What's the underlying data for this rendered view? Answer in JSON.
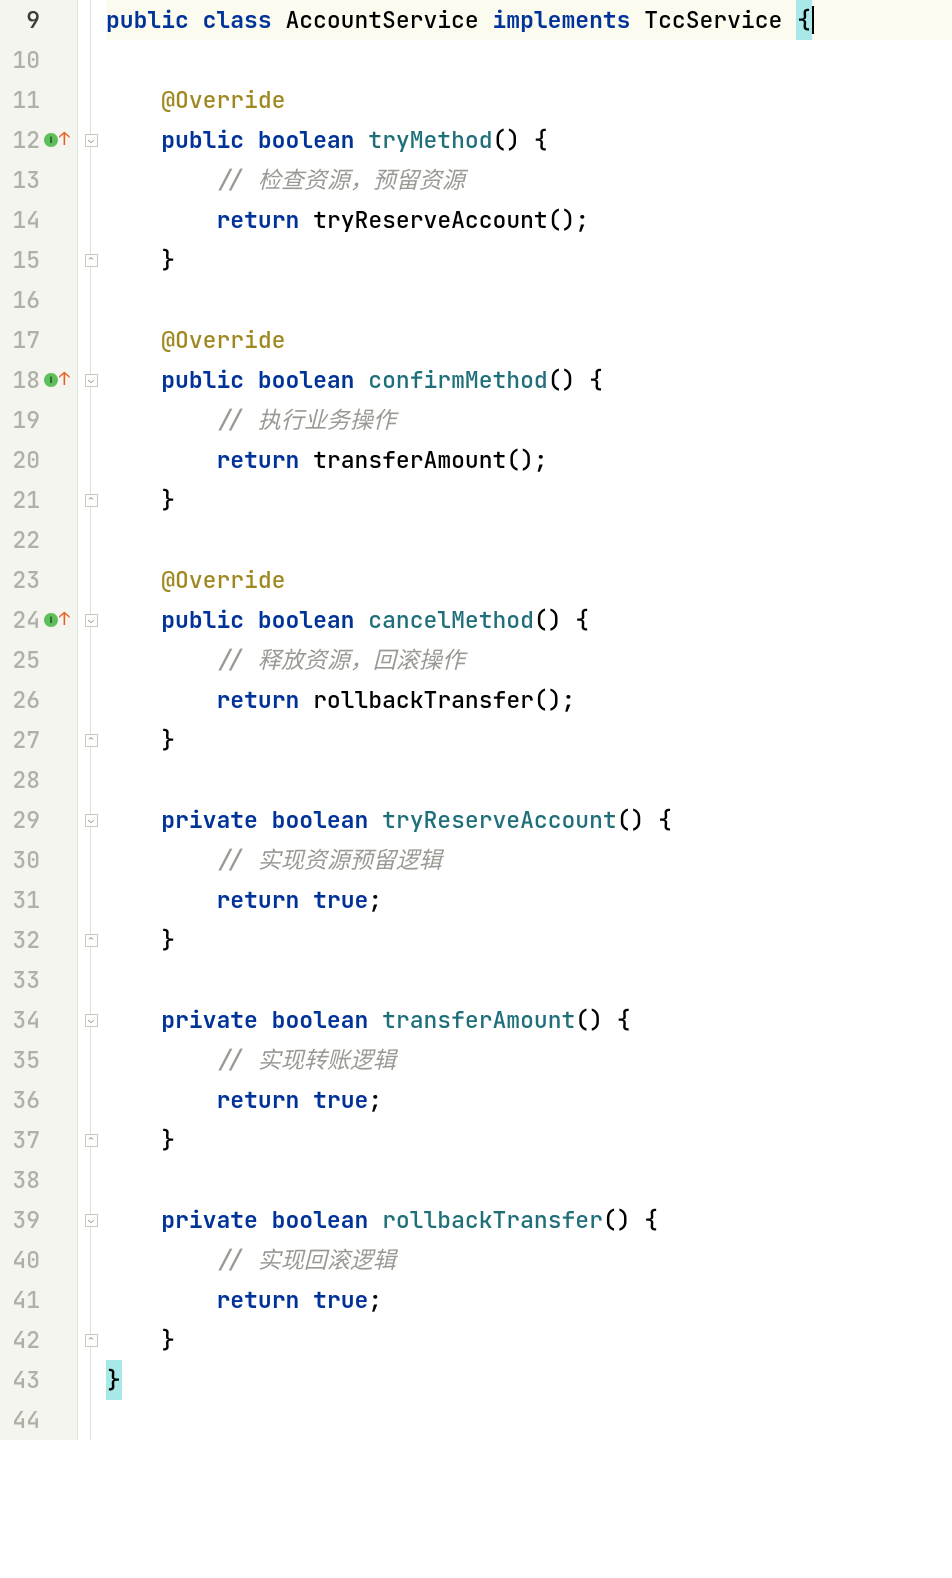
{
  "code": {
    "lines": [
      {
        "n": 9,
        "cur": true,
        "marker": "",
        "fold": "",
        "t": [
          [
            "kw",
            "public"
          ],
          [
            "sp",
            " "
          ],
          [
            "kw",
            "class"
          ],
          [
            "sp",
            " "
          ],
          [
            "cls",
            "AccountService"
          ],
          [
            "sp",
            " "
          ],
          [
            "kw",
            "implements"
          ],
          [
            "sp",
            " "
          ],
          [
            "cls",
            "TccService"
          ],
          [
            "sp",
            " "
          ],
          [
            "hl-brace",
            "{"
          ],
          [
            "cursor",
            ""
          ]
        ]
      },
      {
        "n": 10,
        "marker": "",
        "fold": "",
        "t": []
      },
      {
        "n": 11,
        "marker": "",
        "fold": "",
        "t": [
          [
            "ind",
            "    "
          ],
          [
            "ann",
            "@Override"
          ]
        ]
      },
      {
        "n": 12,
        "marker": "iarrow",
        "fold": "open",
        "t": [
          [
            "ind",
            "    "
          ],
          [
            "kw",
            "public"
          ],
          [
            "sp",
            " "
          ],
          [
            "kw",
            "boolean"
          ],
          [
            "sp",
            " "
          ],
          [
            "mname",
            "tryMethod"
          ],
          [
            "cls",
            "() {"
          ]
        ]
      },
      {
        "n": 13,
        "marker": "",
        "fold": "",
        "t": [
          [
            "ind",
            "        "
          ],
          [
            "com",
            "// "
          ],
          [
            "com-zh",
            "检查资源，预留资源"
          ]
        ]
      },
      {
        "n": 14,
        "marker": "",
        "fold": "",
        "t": [
          [
            "ind",
            "        "
          ],
          [
            "kw",
            "return"
          ],
          [
            "sp",
            " "
          ],
          [
            "cls",
            "tryReserveAccount();"
          ]
        ]
      },
      {
        "n": 15,
        "marker": "",
        "fold": "close",
        "t": [
          [
            "ind",
            "    "
          ],
          [
            "cls",
            "}"
          ]
        ]
      },
      {
        "n": 16,
        "marker": "",
        "fold": "",
        "t": []
      },
      {
        "n": 17,
        "marker": "",
        "fold": "",
        "t": [
          [
            "ind",
            "    "
          ],
          [
            "ann",
            "@Override"
          ]
        ]
      },
      {
        "n": 18,
        "marker": "iarrow",
        "fold": "open",
        "t": [
          [
            "ind",
            "    "
          ],
          [
            "kw",
            "public"
          ],
          [
            "sp",
            " "
          ],
          [
            "kw",
            "boolean"
          ],
          [
            "sp",
            " "
          ],
          [
            "mname",
            "confirmMethod"
          ],
          [
            "cls",
            "() {"
          ]
        ]
      },
      {
        "n": 19,
        "marker": "",
        "fold": "",
        "t": [
          [
            "ind",
            "        "
          ],
          [
            "com",
            "// "
          ],
          [
            "com-zh",
            "执行业务操作"
          ]
        ]
      },
      {
        "n": 20,
        "marker": "",
        "fold": "",
        "t": [
          [
            "ind",
            "        "
          ],
          [
            "kw",
            "return"
          ],
          [
            "sp",
            " "
          ],
          [
            "cls",
            "transferAmount();"
          ]
        ]
      },
      {
        "n": 21,
        "marker": "",
        "fold": "close",
        "t": [
          [
            "ind",
            "    "
          ],
          [
            "cls",
            "}"
          ]
        ]
      },
      {
        "n": 22,
        "marker": "",
        "fold": "",
        "t": []
      },
      {
        "n": 23,
        "marker": "",
        "fold": "",
        "t": [
          [
            "ind",
            "    "
          ],
          [
            "ann",
            "@Override"
          ]
        ]
      },
      {
        "n": 24,
        "marker": "iarrow",
        "fold": "open",
        "t": [
          [
            "ind",
            "    "
          ],
          [
            "kw",
            "public"
          ],
          [
            "sp",
            " "
          ],
          [
            "kw",
            "boolean"
          ],
          [
            "sp",
            " "
          ],
          [
            "mname",
            "cancelMethod"
          ],
          [
            "cls",
            "() {"
          ]
        ]
      },
      {
        "n": 25,
        "marker": "",
        "fold": "",
        "t": [
          [
            "ind",
            "        "
          ],
          [
            "com",
            "// "
          ],
          [
            "com-zh",
            "释放资源，回滚操作"
          ]
        ]
      },
      {
        "n": 26,
        "marker": "",
        "fold": "",
        "t": [
          [
            "ind",
            "        "
          ],
          [
            "kw",
            "return"
          ],
          [
            "sp",
            " "
          ],
          [
            "cls",
            "rollbackTransfer();"
          ]
        ]
      },
      {
        "n": 27,
        "marker": "",
        "fold": "close",
        "t": [
          [
            "ind",
            "    "
          ],
          [
            "cls",
            "}"
          ]
        ]
      },
      {
        "n": 28,
        "marker": "",
        "fold": "",
        "t": []
      },
      {
        "n": 29,
        "marker": "",
        "fold": "open",
        "t": [
          [
            "ind",
            "    "
          ],
          [
            "kw",
            "private"
          ],
          [
            "sp",
            " "
          ],
          [
            "kw",
            "boolean"
          ],
          [
            "sp",
            " "
          ],
          [
            "mname",
            "tryReserveAccount"
          ],
          [
            "cls",
            "() {"
          ]
        ]
      },
      {
        "n": 30,
        "marker": "",
        "fold": "",
        "t": [
          [
            "ind",
            "        "
          ],
          [
            "com",
            "// "
          ],
          [
            "com-zh",
            "实现资源预留逻辑"
          ]
        ]
      },
      {
        "n": 31,
        "marker": "",
        "fold": "",
        "t": [
          [
            "ind",
            "        "
          ],
          [
            "kw",
            "return"
          ],
          [
            "sp",
            " "
          ],
          [
            "kw",
            "true"
          ],
          [
            "cls",
            ";"
          ]
        ]
      },
      {
        "n": 32,
        "marker": "",
        "fold": "close",
        "t": [
          [
            "ind",
            "    "
          ],
          [
            "cls",
            "}"
          ]
        ]
      },
      {
        "n": 33,
        "marker": "",
        "fold": "",
        "t": []
      },
      {
        "n": 34,
        "marker": "",
        "fold": "open",
        "t": [
          [
            "ind",
            "    "
          ],
          [
            "kw",
            "private"
          ],
          [
            "sp",
            " "
          ],
          [
            "kw",
            "boolean"
          ],
          [
            "sp",
            " "
          ],
          [
            "mname",
            "transferAmount"
          ],
          [
            "cls",
            "() {"
          ]
        ]
      },
      {
        "n": 35,
        "marker": "",
        "fold": "",
        "t": [
          [
            "ind",
            "        "
          ],
          [
            "com",
            "// "
          ],
          [
            "com-zh",
            "实现转账逻辑"
          ]
        ]
      },
      {
        "n": 36,
        "marker": "",
        "fold": "",
        "t": [
          [
            "ind",
            "        "
          ],
          [
            "kw",
            "return"
          ],
          [
            "sp",
            " "
          ],
          [
            "kw",
            "true"
          ],
          [
            "cls",
            ";"
          ]
        ]
      },
      {
        "n": 37,
        "marker": "",
        "fold": "close",
        "t": [
          [
            "ind",
            "    "
          ],
          [
            "cls",
            "}"
          ]
        ]
      },
      {
        "n": 38,
        "marker": "",
        "fold": "",
        "t": []
      },
      {
        "n": 39,
        "marker": "",
        "fold": "open",
        "t": [
          [
            "ind",
            "    "
          ],
          [
            "kw",
            "private"
          ],
          [
            "sp",
            " "
          ],
          [
            "kw",
            "boolean"
          ],
          [
            "sp",
            " "
          ],
          [
            "mname",
            "rollbackTransfer"
          ],
          [
            "cls",
            "() {"
          ]
        ]
      },
      {
        "n": 40,
        "marker": "",
        "fold": "",
        "t": [
          [
            "ind",
            "        "
          ],
          [
            "com",
            "// "
          ],
          [
            "com-zh",
            "实现回滚逻辑"
          ]
        ]
      },
      {
        "n": 41,
        "marker": "",
        "fold": "",
        "t": [
          [
            "ind",
            "        "
          ],
          [
            "kw",
            "return"
          ],
          [
            "sp",
            " "
          ],
          [
            "kw",
            "true"
          ],
          [
            "cls",
            ";"
          ]
        ]
      },
      {
        "n": 42,
        "marker": "",
        "fold": "close",
        "t": [
          [
            "ind",
            "    "
          ],
          [
            "cls",
            "}"
          ]
        ]
      },
      {
        "n": 43,
        "marker": "",
        "fold": "",
        "t": [
          [
            "hl-brace",
            "}"
          ]
        ]
      },
      {
        "n": 44,
        "marker": "",
        "fold": "",
        "t": []
      }
    ]
  },
  "glyphs": {
    "markerI": "I",
    "arrowUp": "↑",
    "foldOpen": "⌄",
    "foldClose": "⌃"
  }
}
